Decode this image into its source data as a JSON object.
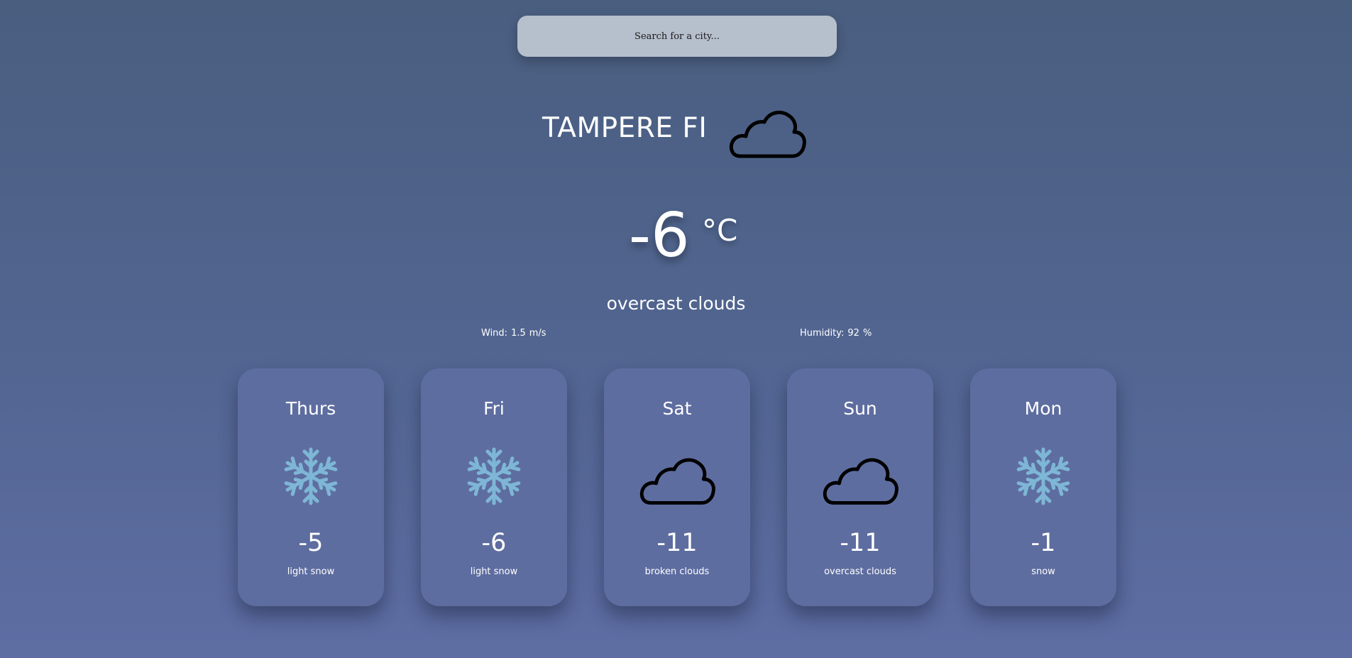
{
  "search": {
    "placeholder": "Search for a city..."
  },
  "current": {
    "city": "TAMPERE FI",
    "icon": "cloud-icon",
    "temperature": "-6",
    "unit": "°C",
    "description": "overcast clouds",
    "wind_label": "Wind:",
    "wind_value": "1.5",
    "wind_unit": "m/s",
    "humidity_label": "Humidity:",
    "humidity_value": "92",
    "humidity_unit": "%"
  },
  "forecast": [
    {
      "day": "Thurs",
      "icon": "snowflake-icon",
      "temp": "-5",
      "desc": "light snow"
    },
    {
      "day": "Fri",
      "icon": "snowflake-icon",
      "temp": "-6",
      "desc": "light snow"
    },
    {
      "day": "Sat",
      "icon": "cloud-icon",
      "temp": "-11",
      "desc": "broken clouds"
    },
    {
      "day": "Sun",
      "icon": "cloud-icon",
      "temp": "-11",
      "desc": "overcast clouds"
    },
    {
      "day": "Mon",
      "icon": "snowflake-icon",
      "temp": "-1",
      "desc": "snow"
    }
  ],
  "colors": {
    "snow_icon": "#7eb6d6",
    "cloud_icon": "#000000",
    "card_bg": "#5e6da0",
    "search_bg": "#b6bfcc"
  }
}
